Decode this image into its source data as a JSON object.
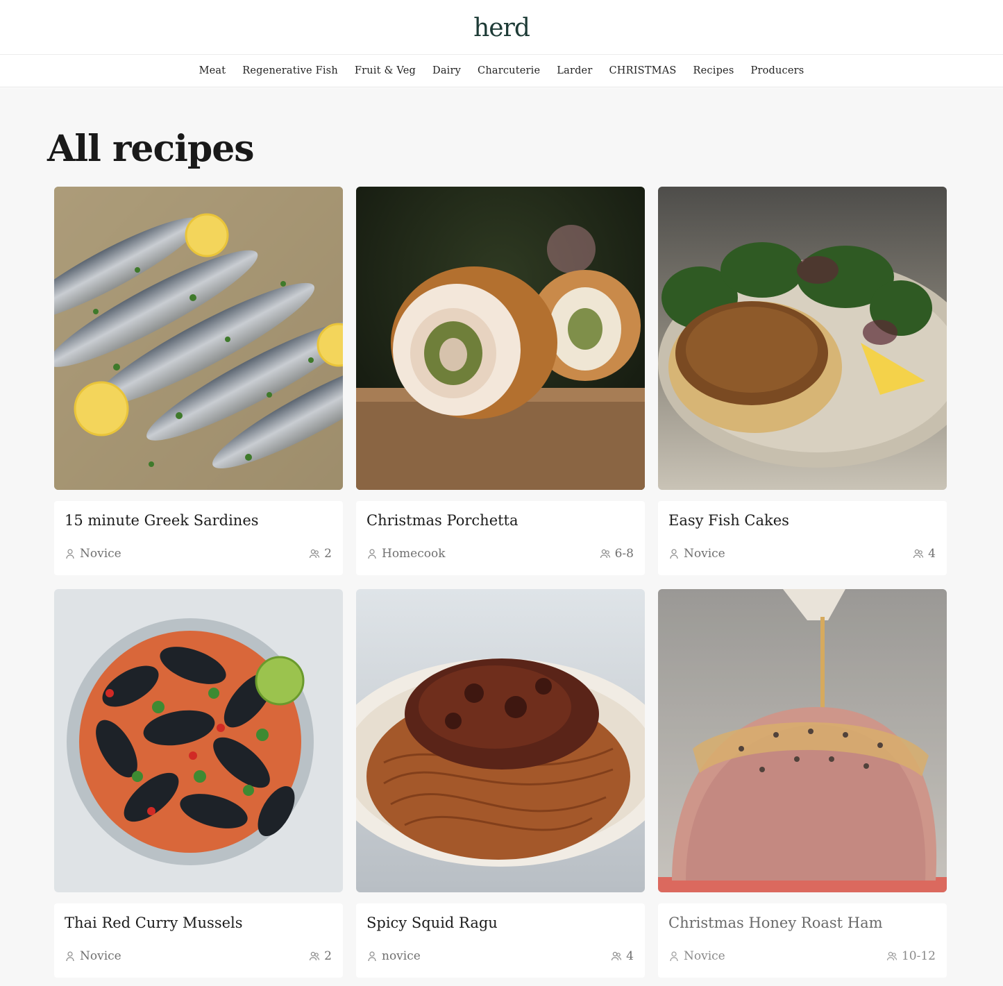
{
  "brand": {
    "logo": "herd"
  },
  "nav": {
    "items": [
      "Meat",
      "Regenerative Fish",
      "Fruit & Veg",
      "Dairy",
      "Charcuterie",
      "Larder",
      "CHRISTMAS",
      "Recipes",
      "Producers"
    ]
  },
  "page": {
    "title": "All recipes"
  },
  "recipes": [
    {
      "title": "15 minute Greek Sardines",
      "difficulty": "Novice",
      "serves": "2"
    },
    {
      "title": "Christmas Porchetta",
      "difficulty": "Homecook",
      "serves": "6-8"
    },
    {
      "title": "Easy Fish Cakes",
      "difficulty": "Novice",
      "serves": "4"
    },
    {
      "title": "Thai Red Curry Mussels",
      "difficulty": "Novice",
      "serves": "2"
    },
    {
      "title": "Spicy Squid Ragu",
      "difficulty": "novice",
      "serves": "4"
    },
    {
      "title": "Christmas Honey Roast Ham",
      "difficulty": "Novice",
      "serves": "10-12"
    }
  ],
  "colors": {
    "brand": "#1d3b36",
    "background": "#f7f7f7",
    "card": "#ffffff",
    "meta_text": "#707070"
  },
  "icons": {
    "difficulty": "chef-person-icon",
    "serves": "people-icon"
  }
}
